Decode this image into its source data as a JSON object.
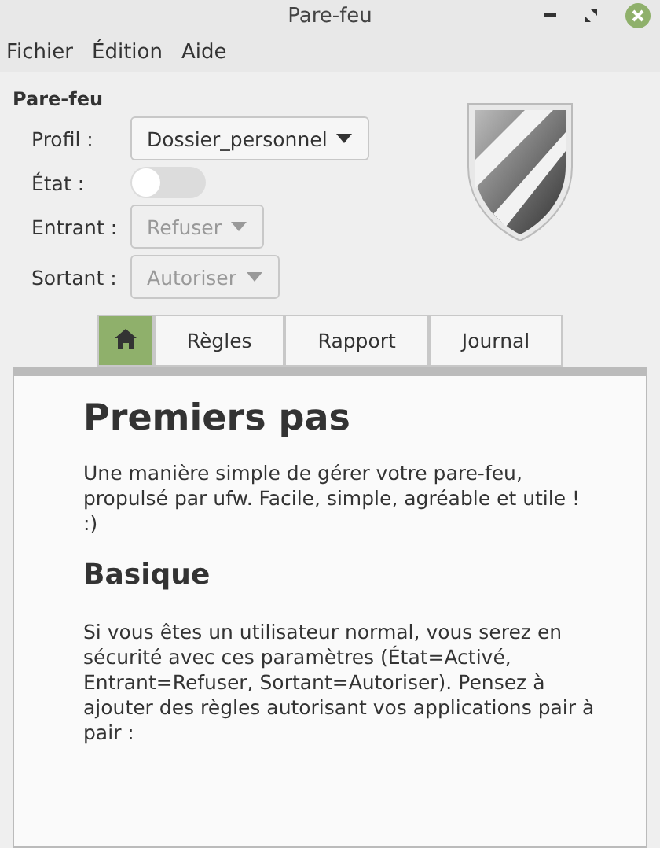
{
  "window": {
    "title": "Pare-feu"
  },
  "menu": [
    "Fichier",
    "Édition",
    "Aide"
  ],
  "section_title": "Pare-feu",
  "fields": [
    {
      "label": "Profil :",
      "kind": "dropdown",
      "value": "Dossier_personnel",
      "disabled": false
    },
    {
      "label": "État :",
      "kind": "switch",
      "on": false
    },
    {
      "label": "Entrant :",
      "kind": "dropdown",
      "value": "Refuser",
      "disabled": true
    },
    {
      "label": "Sortant :",
      "kind": "dropdown",
      "value": "Autoriser",
      "disabled": true
    }
  ],
  "tabs": [
    {
      "kind": "icon",
      "selected": true
    },
    {
      "kind": "text",
      "label": "Règles",
      "selected": false
    },
    {
      "kind": "text",
      "label": "Rapport",
      "selected": false
    },
    {
      "kind": "text",
      "label": "Journal",
      "selected": false
    }
  ],
  "document": {
    "heading": "Premiers pas",
    "intro": "Une manière simple de gérer votre pare-feu, propulsé par ufw. Facile, simple, agréable et utile ! :)",
    "subheading": "Basique",
    "body": "Si vous êtes un utilisateur normal, vous serez en sécurité avec ces paramètres (État=Activé, Entrant=Refuser, Sortant=Autoriser). Pensez à ajouter des règles autorisant vos applications pair à pair :"
  }
}
